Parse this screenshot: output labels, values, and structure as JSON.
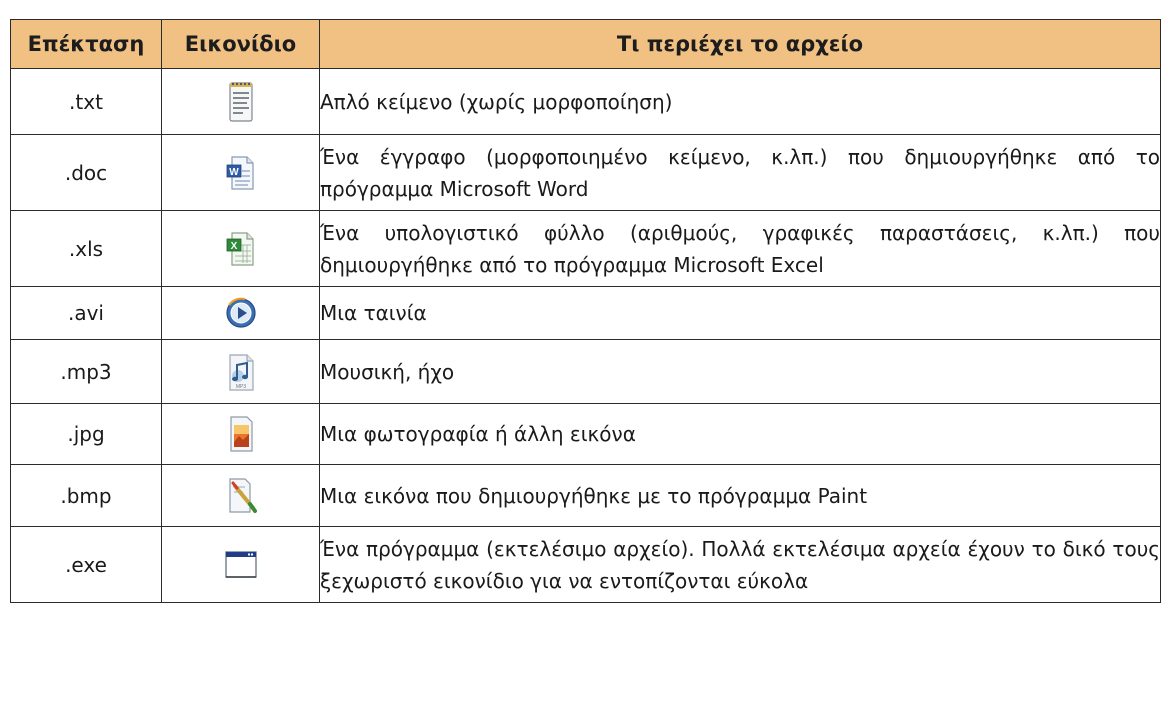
{
  "headers": {
    "extension": "Επέκταση",
    "icon": "Εικονίδιο",
    "content": "Τι περιέχει το αρχείο"
  },
  "rows": [
    {
      "ext": ".txt",
      "icon": "notepad-text-file-icon",
      "desc": "Απλό κείμενο (χωρίς μορφοποίηση)"
    },
    {
      "ext": ".doc",
      "icon": "word-document-icon",
      "desc": "Ένα έγγραφο (μορφοποιημένο κείμενο, κ.λπ.) που δημιουργήθηκε από το πρόγραμμα Microsoft Word"
    },
    {
      "ext": ".xls",
      "icon": "excel-spreadsheet-icon",
      "desc": "Ένα υπολογιστικό φύλλο (αριθμούς, γραφικές παραστάσεις, κ.λπ.) που δημιουργήθηκε από το πρόγραμμα Microsoft Excel"
    },
    {
      "ext": ".avi",
      "icon": "media-player-video-icon",
      "desc": "Μια ταινία"
    },
    {
      "ext": ".mp3",
      "icon": "music-audio-file-icon",
      "desc": "Μουσική, ήχο"
    },
    {
      "ext": ".jpg",
      "icon": "jpeg-image-file-icon",
      "desc": "Μια φωτογραφία ή άλλη εικόνα"
    },
    {
      "ext": ".bmp",
      "icon": "paint-bitmap-file-icon",
      "desc": "Μια εικόνα που δημιουργήθηκε με το πρόγραμμα Paint"
    },
    {
      "ext": ".exe",
      "icon": "executable-window-icon",
      "desc": "Ένα πρόγραμμα (εκτελέσιμο αρχείο). Πολλά εκτελέσιμα αρχεία έχουν το δικό τους ξεχωριστό εικονίδιο για να εντοπίζονται εύκολα"
    }
  ],
  "colors": {
    "header_bg": "#f1c083",
    "border": "#2b2b2b"
  }
}
